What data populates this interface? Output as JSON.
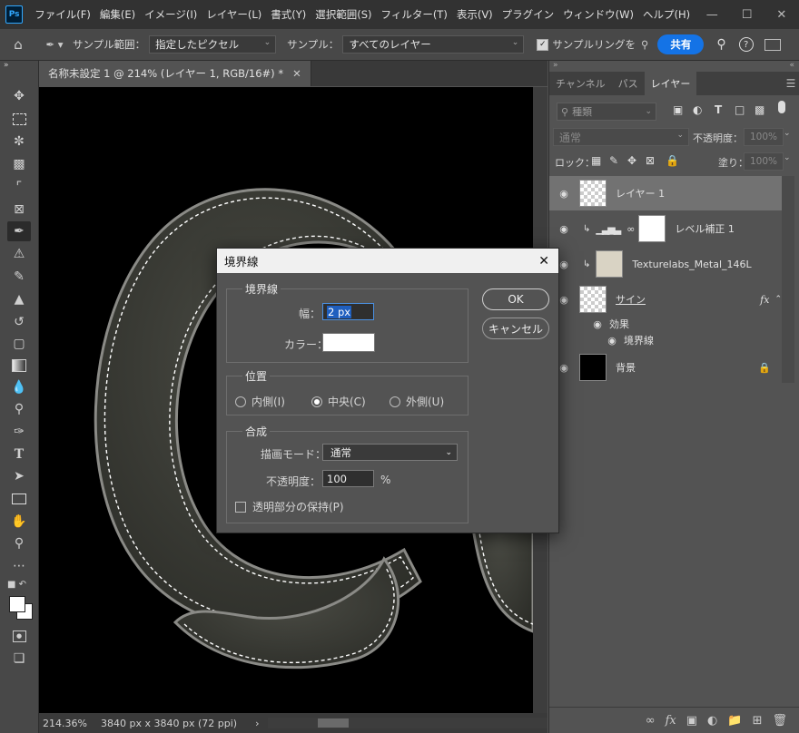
{
  "menubar": {
    "logo": "Ps",
    "items": [
      "ファイル(F)",
      "編集(E)",
      "イメージ(I)",
      "レイヤー(L)",
      "書式(Y)",
      "選択範囲(S)",
      "フィルター(T)",
      "表示(V)",
      "プラグイン",
      "ウィンドウ(W)",
      "ヘルプ(H)"
    ]
  },
  "options": {
    "sample_size_label": "サンプル範囲：",
    "sample_size_value": "指定したピクセル",
    "sample_label": "サンプル：",
    "sample_value": "すべてのレイヤー",
    "sampling_ring_label": "サンプルリングを",
    "share_label": "共有"
  },
  "document": {
    "tab_title": "名称未設定 1 @ 214% (レイヤー 1, RGB/16#) *",
    "zoom": "214.36%",
    "size_info": "3840 px x 3840 px (72 ppi)"
  },
  "panel": {
    "tabs": [
      "チャンネル",
      "パス",
      "レイヤー"
    ],
    "active_tab": "レイヤー",
    "filter_placeholder": "種類",
    "blend_mode": "通常",
    "opacity_label": "不透明度：",
    "opacity_value": "100%",
    "lock_label": "ロック：",
    "fill_label": "塗り：",
    "fill_value": "100%",
    "layers": [
      {
        "name": "レイヤー 1"
      },
      {
        "name": "レベル補正 1"
      },
      {
        "name": "Texturelabs_Metal_146L"
      },
      {
        "name": "サイン",
        "fx": "fx"
      },
      {
        "name": "効果"
      },
      {
        "name": "境界線"
      },
      {
        "name": "背景"
      }
    ]
  },
  "dialog": {
    "title": "境界線",
    "stroke_group": "境界線",
    "width_label": "幅：",
    "width_value": "2 px",
    "color_label": "カラー：",
    "color_value": "#ffffff",
    "position_group": "位置",
    "positions": [
      "内側(I)",
      "中央(C)",
      "外側(U)"
    ],
    "selected_position": "中央(C)",
    "blend_group": "合成",
    "mode_label": "描画モード：",
    "mode_value": "通常",
    "opacity_label": "不透明度：",
    "opacity_value": "100",
    "percent": "%",
    "preserve_label": "透明部分の保持(P)",
    "ok_label": "OK",
    "cancel_label": "キャンセル"
  },
  "colors": {
    "accent": "#1473e6",
    "metal": "#3b3c36",
    "metal_edge": "#8a8a86"
  }
}
